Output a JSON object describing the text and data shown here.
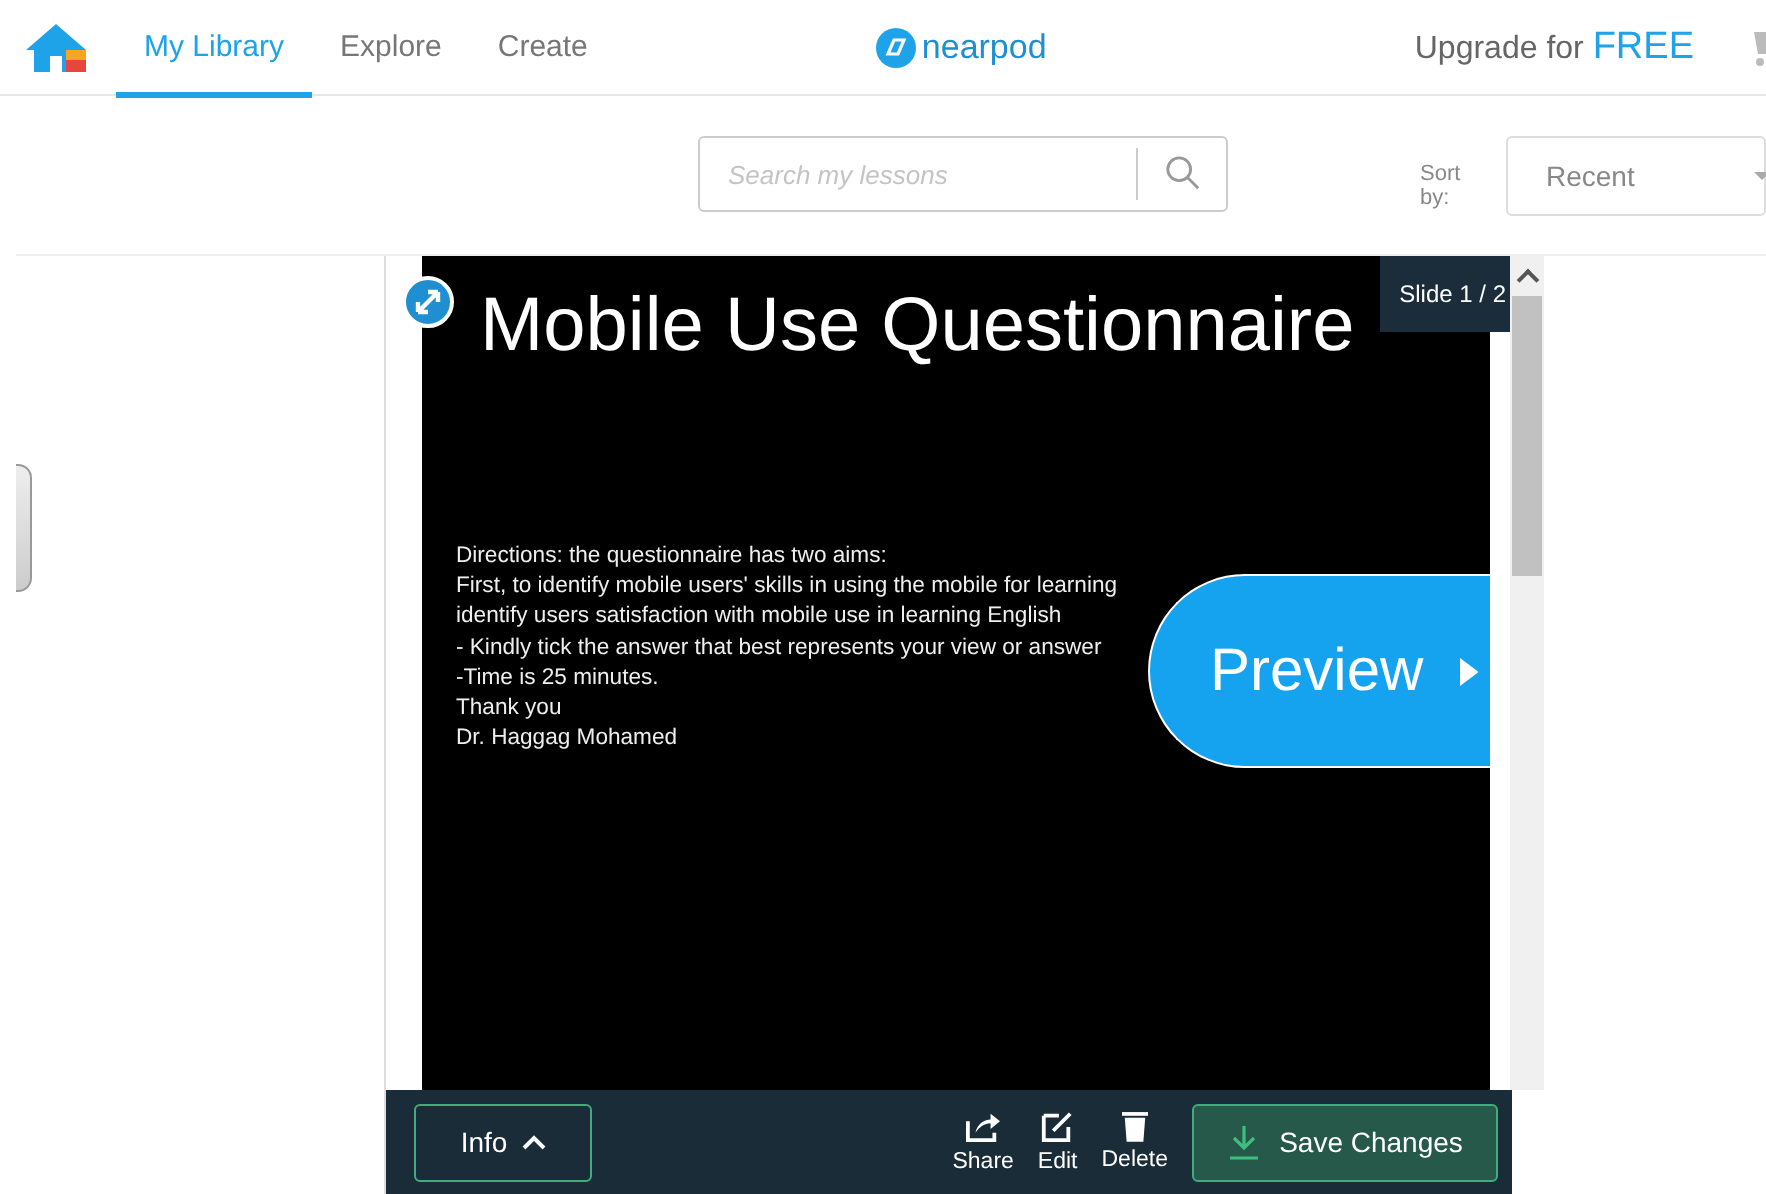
{
  "nav": {
    "tabs": [
      {
        "label": "My Library",
        "selected": true
      },
      {
        "label": "Explore",
        "selected": false
      },
      {
        "label": "Create",
        "selected": false
      }
    ],
    "logo": "nearpod",
    "upgrade": {
      "text": "Upgrade for",
      "highlight": "FREE"
    }
  },
  "toolbar": {
    "search": {
      "placeholder": "Search my lessons"
    },
    "sort": {
      "label": "Sort by:",
      "value": "Recent"
    }
  },
  "slide": {
    "title": "Mobile Use Questionnaire",
    "counter": "Slide 1 / 2",
    "lines": [
      "Directions: the questionnaire has two aims:",
      "First, to identify mobile users' skills in using the mobile for learning",
      "identify users satisfaction with mobile use in learning English",
      "- Kindly tick the answer that best represents your view or answer",
      "-Time is 25 minutes.",
      "Thank you",
      "Dr. Haggag Mohamed"
    ],
    "preview": "Preview"
  },
  "actions": {
    "info": "Info",
    "tools": [
      {
        "kind": "share",
        "label": "Share"
      },
      {
        "kind": "edit",
        "label": "Edit"
      },
      {
        "kind": "delete",
        "label": "Delete"
      }
    ],
    "save": "Save Changes"
  }
}
